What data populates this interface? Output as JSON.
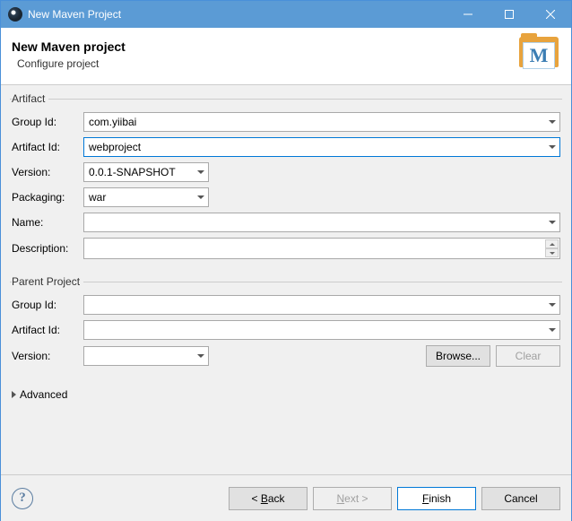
{
  "window": {
    "title": "New Maven Project"
  },
  "header": {
    "title": "New Maven project",
    "subtitle": "Configure project",
    "icon_letter": "M"
  },
  "artifact": {
    "legend": "Artifact",
    "groupId_label": "Group Id:",
    "groupId": "com.yiibai",
    "artifactId_label": "Artifact Id:",
    "artifactId": "webproject",
    "version_label": "Version:",
    "version": "0.0.1-SNAPSHOT",
    "packaging_label": "Packaging:",
    "packaging": "war",
    "name_label": "Name:",
    "name": "",
    "description_label": "Description:",
    "description": ""
  },
  "parent": {
    "legend": "Parent Project",
    "groupId_label": "Group Id:",
    "groupId": "",
    "artifactId_label": "Artifact Id:",
    "artifactId": "",
    "version_label": "Version:",
    "version": "",
    "browse_label": "Browse...",
    "clear_label": "Clear"
  },
  "advanced": {
    "label": "Advanced"
  },
  "footer": {
    "back": "< Back",
    "next": "Next >",
    "finish": "Finish",
    "cancel": "Cancel"
  }
}
